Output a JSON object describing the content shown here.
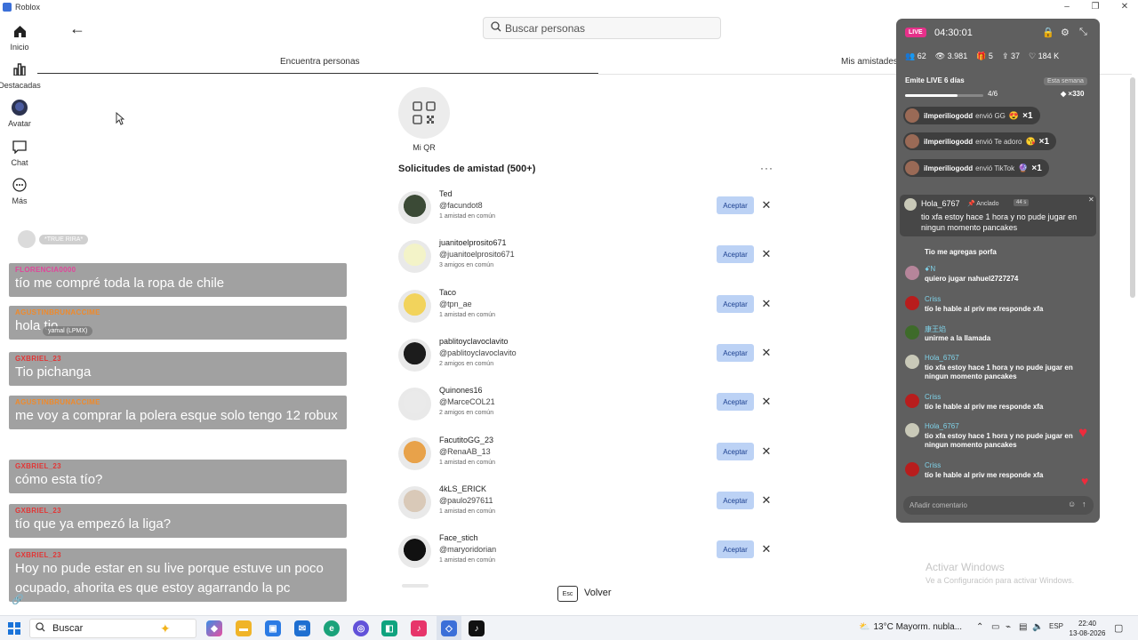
{
  "window": {
    "title": "Roblox"
  },
  "nav": {
    "items": [
      {
        "label": "Inicio",
        "icon": "home-icon"
      },
      {
        "label": "Destacadas",
        "icon": "chart-icon"
      },
      {
        "label": "Avatar",
        "icon": "avatar-icon"
      },
      {
        "label": "Chat",
        "icon": "chat-icon"
      },
      {
        "label": "Más",
        "icon": "more-icon"
      }
    ]
  },
  "search": {
    "placeholder": "Buscar personas"
  },
  "tabs": {
    "find": "Encuentra personas",
    "friends": "Mis amistades"
  },
  "qr": {
    "label": "Mi QR"
  },
  "requests": {
    "title": "Solicitudes de amistad (500+)",
    "accept_label": "Aceptar",
    "items": [
      {
        "name": "Ted",
        "handle": "@facundot8",
        "mutual": "1 amistad en común"
      },
      {
        "name": "juanitoelprosito671",
        "handle": "@juanitoelprosito671",
        "mutual": "3 amigos en común"
      },
      {
        "name": "Taco",
        "handle": "@tpn_ae",
        "mutual": "1 amistad en común"
      },
      {
        "name": "pablitoyclavoclavito",
        "handle": "@pablitoyclavoclavito",
        "mutual": "2 amigos en común"
      },
      {
        "name": "Quinones16",
        "handle": "@MarceCOL21",
        "mutual": "2 amigos en común"
      },
      {
        "name": "FacutitoGG_23",
        "handle": "@RenaAB_13",
        "mutual": "1 amistad en común"
      },
      {
        "name": "4kLS_ERICK",
        "handle": "@paulo297611",
        "mutual": "1 amistad en común"
      },
      {
        "name": "Face_stich",
        "handle": "@maryoridorian",
        "mutual": "1 amistad en común"
      }
    ]
  },
  "footer": {
    "esc": "Esc",
    "back": "Volver"
  },
  "overlay_chat": {
    "ghost_tags": [
      "*TRUE RIRA*",
      "yamal (LPMX)"
    ],
    "messages": [
      {
        "user": "FLORENCIA0000",
        "text": "tío me compré toda la ropa de chile"
      },
      {
        "user": "AGUSTINBRUNACCIME",
        "text": "hola tio"
      },
      {
        "user": "GXBRIEL_23",
        "text": "Tio pichanga"
      },
      {
        "user": "AGUSTINBRUNACCIME",
        "text": "me voy a comprar la polera esque solo tengo 12 robux"
      },
      {
        "user": "GXBRIEL_23",
        "text": "cómo esta tío?"
      },
      {
        "user": "GXBRIEL_23",
        "text": "tío que ya empezó la liga?"
      },
      {
        "user": "GXBRIEL_23",
        "text": "Hoy no pude estar en su live porque estuve un poco ocupado, ahorita es que estoy agarrando la pc"
      }
    ]
  },
  "live": {
    "badge": "LIVE",
    "timer": "04:30:01",
    "stats": {
      "people": "62",
      "views": "3.981",
      "gifts": "5",
      "shares": "37",
      "likes": "184 K"
    },
    "streak": {
      "label": "Emite LIVE 6 días",
      "week": "Esta semana",
      "count": "4/6",
      "progress": 0.67,
      "multiplier": "×330"
    },
    "gifts": [
      {
        "user": "ilmperiliogodd",
        "action": "envió GG",
        "icon": "gg-sticker-icon",
        "count": "×1"
      },
      {
        "user": "ilmperiliogodd",
        "action": "envió Te adoro",
        "icon": "heart-face-icon",
        "count": "×1"
      },
      {
        "user": "ilmperiliogodd",
        "action": "envió TikTok",
        "icon": "tiktok-gift-icon",
        "count": "×1"
      }
    ],
    "pinned": {
      "user": "Hola_6767",
      "tag": "Anclado",
      "time": "44 s",
      "text": "tio xfa estoy hace 1 hora y no pude jugar en ningun momento pancakes"
    },
    "comments": [
      {
        "user": "",
        "text": "Tio me agregas porfa"
      },
      {
        "user": "ꗃN",
        "text": "quiero jugar nahuel2727274"
      },
      {
        "user": "Criss",
        "text": "tío le hable al priv me responde xfa"
      },
      {
        "user": "康王焰",
        "text": "unirme a la llamada"
      },
      {
        "user": "Hola_6767",
        "text": "tio xfa estoy hace 1 hora y no pude jugar en ningun momento pancakes"
      },
      {
        "user": "Criss",
        "text": "tío le hable al priv me responde xfa"
      },
      {
        "user": "Hola_6767",
        "text": "tio xfa estoy hace 1 hora y no pude jugar en ningun momento pancakes"
      },
      {
        "user": "Criss",
        "text": "tío le hable al priv me responde xfa"
      }
    ],
    "comment_placeholder": "Añadir comentario"
  },
  "watermark": {
    "title": "Activar Windows",
    "subtitle": "Ve a Configuración para activar Windows."
  },
  "taskbar": {
    "search": "Buscar",
    "weather": "13°C  Mayorm. nubla...",
    "lang": "ESP",
    "time": "22:40",
    "date": "13-08-2026"
  },
  "colors": {
    "accept_bg": "#bcd2f5",
    "live_badge": "#e6308a",
    "username_red": "#e23636"
  }
}
